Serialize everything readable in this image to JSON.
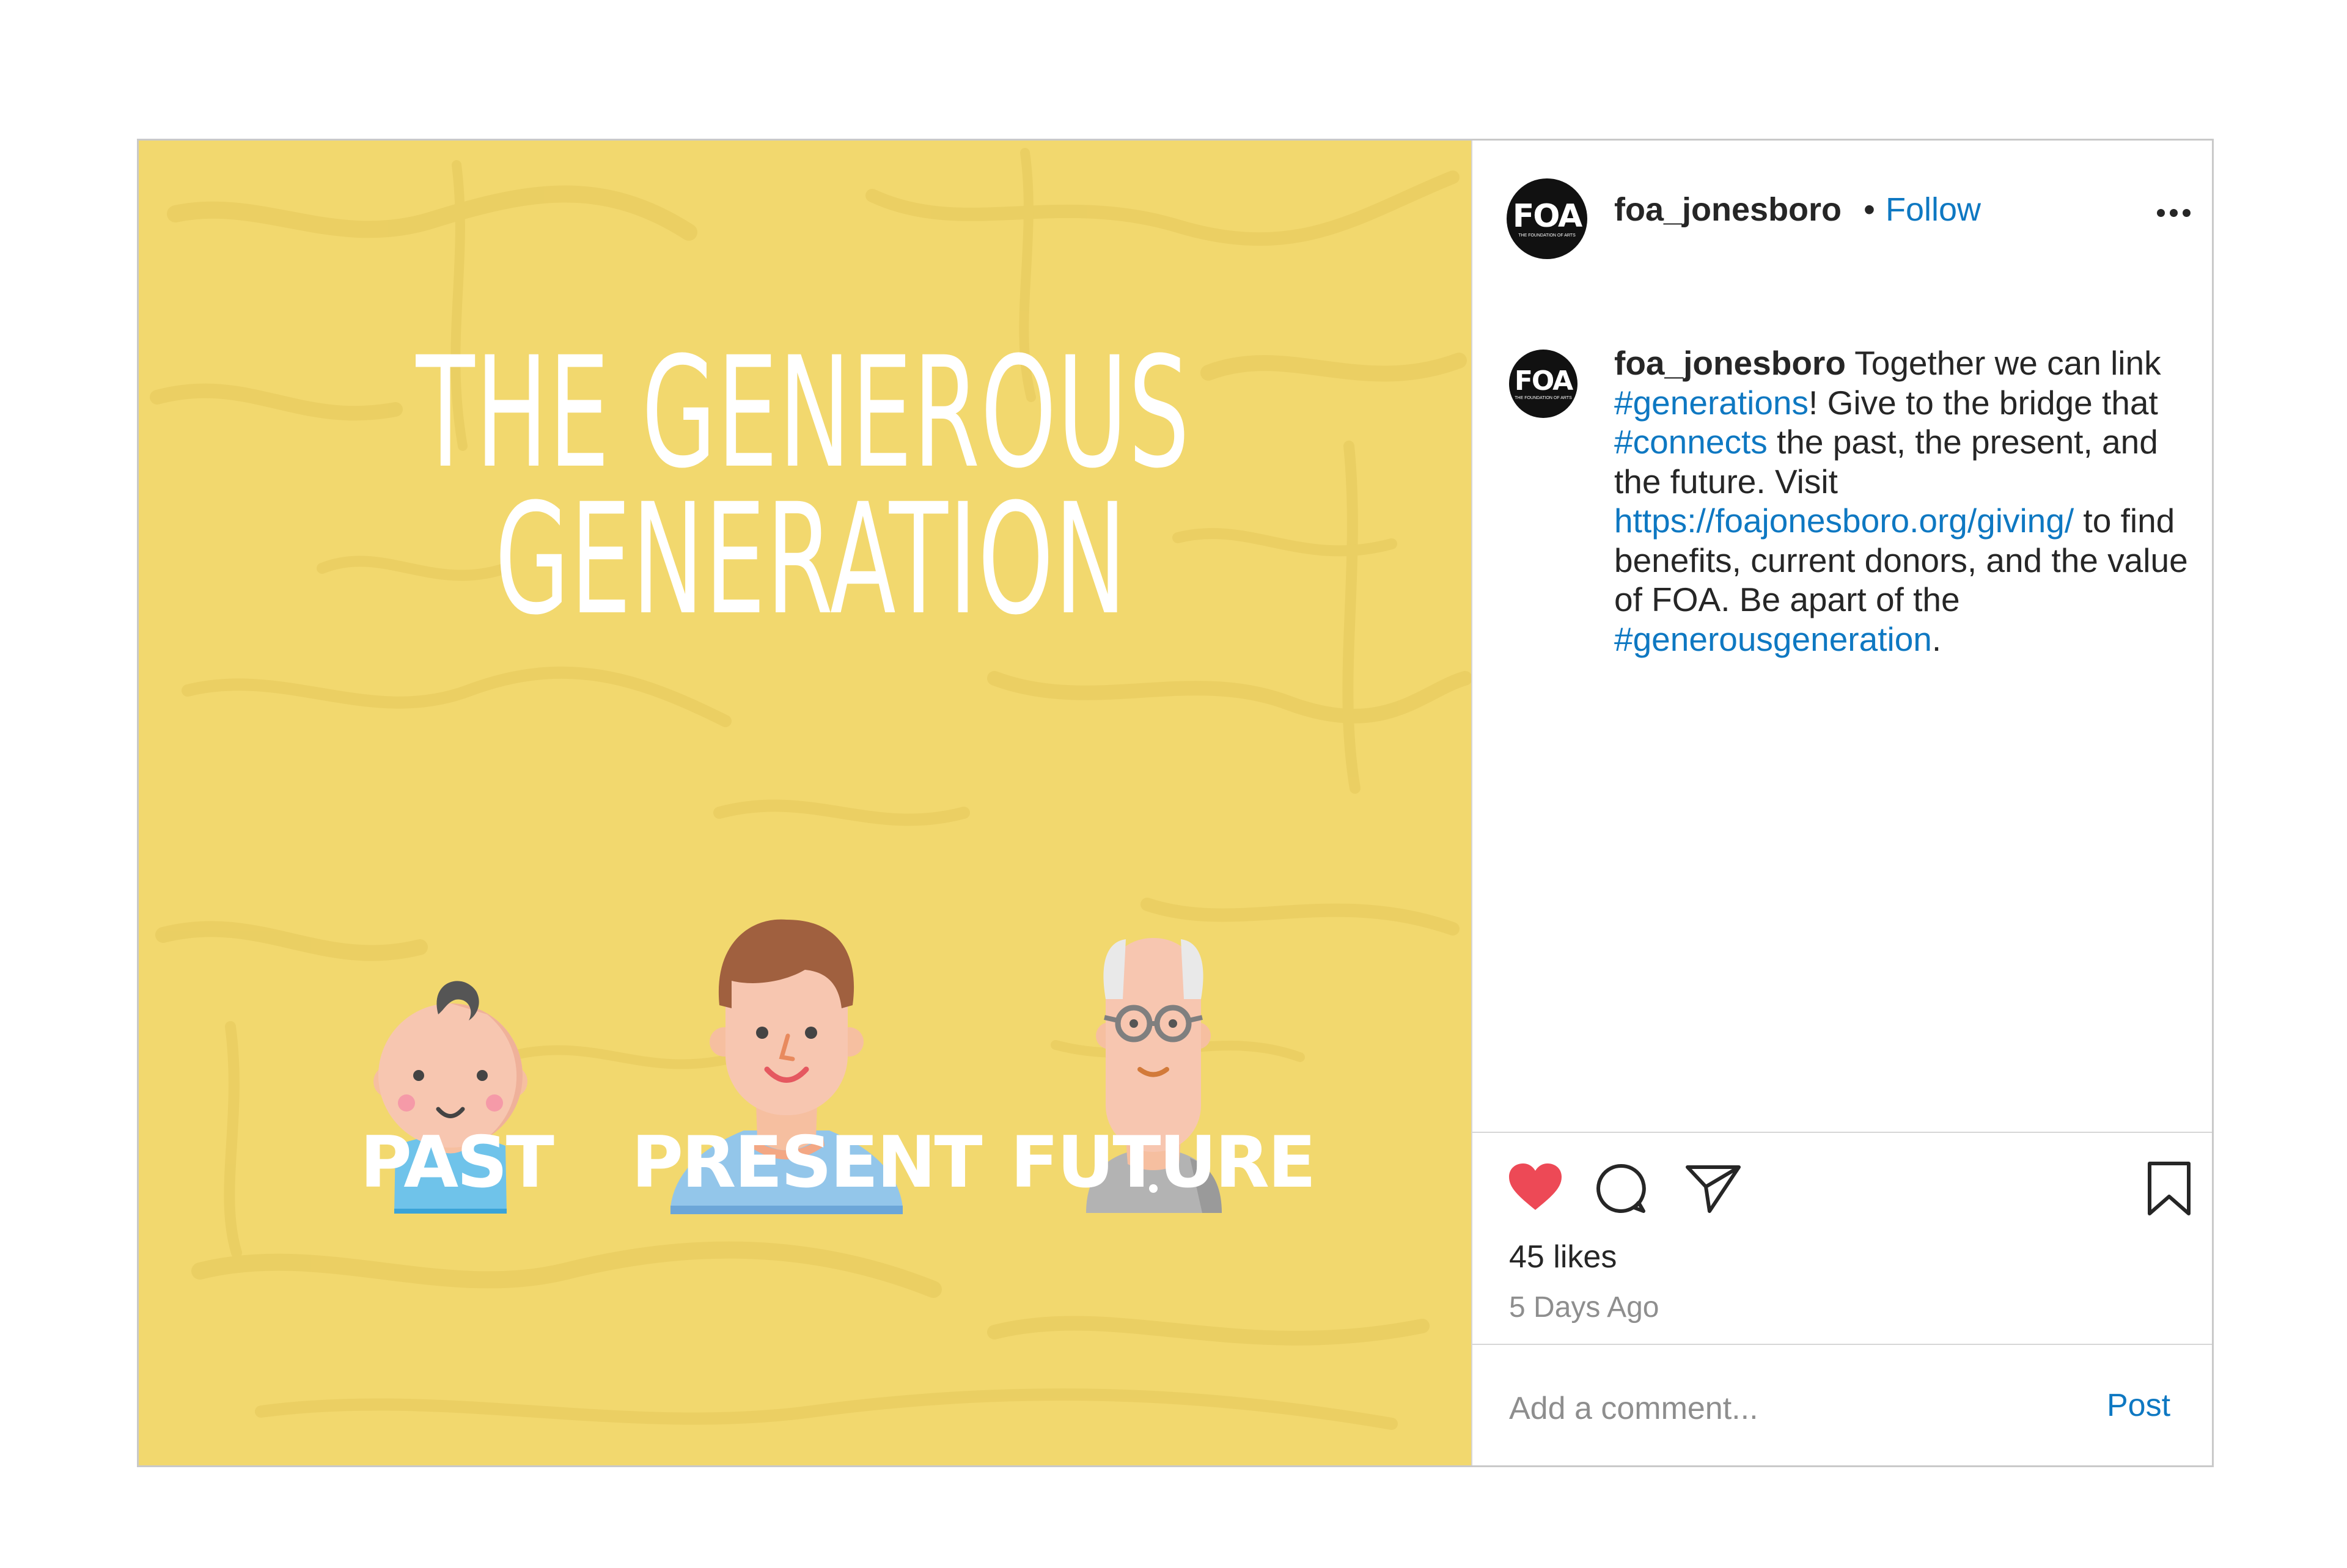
{
  "image": {
    "title_line1": "THE GENEROUS",
    "title_line2": "GENERATION",
    "labels": [
      "PAST",
      "PRESENT",
      "FUTURE"
    ],
    "background_color": "#f2d86e"
  },
  "header": {
    "logo_text": "FOA",
    "logo_subtext": "THE FOUNDATION OF ARTS",
    "username": "foa_jonesboro",
    "separator": "•",
    "follow_label": "Follow",
    "more_icon": "ellipsis-icon"
  },
  "caption": {
    "username": "foa_jonesboro",
    "text_1": " Together we can link ",
    "tag_generations": "#generations",
    "text_2": "! Give to the bridge that ",
    "tag_connects": "#connects",
    "text_3": " the past, the present, and the future. Visit ",
    "url": "https://foajonesboro.org/giving/",
    "text_4": " to find benefits, current donors, and the value of FOA. Be apart of the ",
    "tag_generous": "#generousgeneration",
    "text_5": "."
  },
  "actions": {
    "icons": [
      "heart-icon",
      "comment-icon",
      "share-icon",
      "bookmark-icon"
    ],
    "liked": true,
    "like_color": "#ed4956",
    "likes_text": "45 likes",
    "time_text": "5 Days Ago"
  },
  "comment": {
    "placeholder": "Add a comment...",
    "post_label": "Post"
  },
  "colors": {
    "link": "#0e78c2",
    "text": "#262626",
    "muted": "#8e8e8e"
  }
}
